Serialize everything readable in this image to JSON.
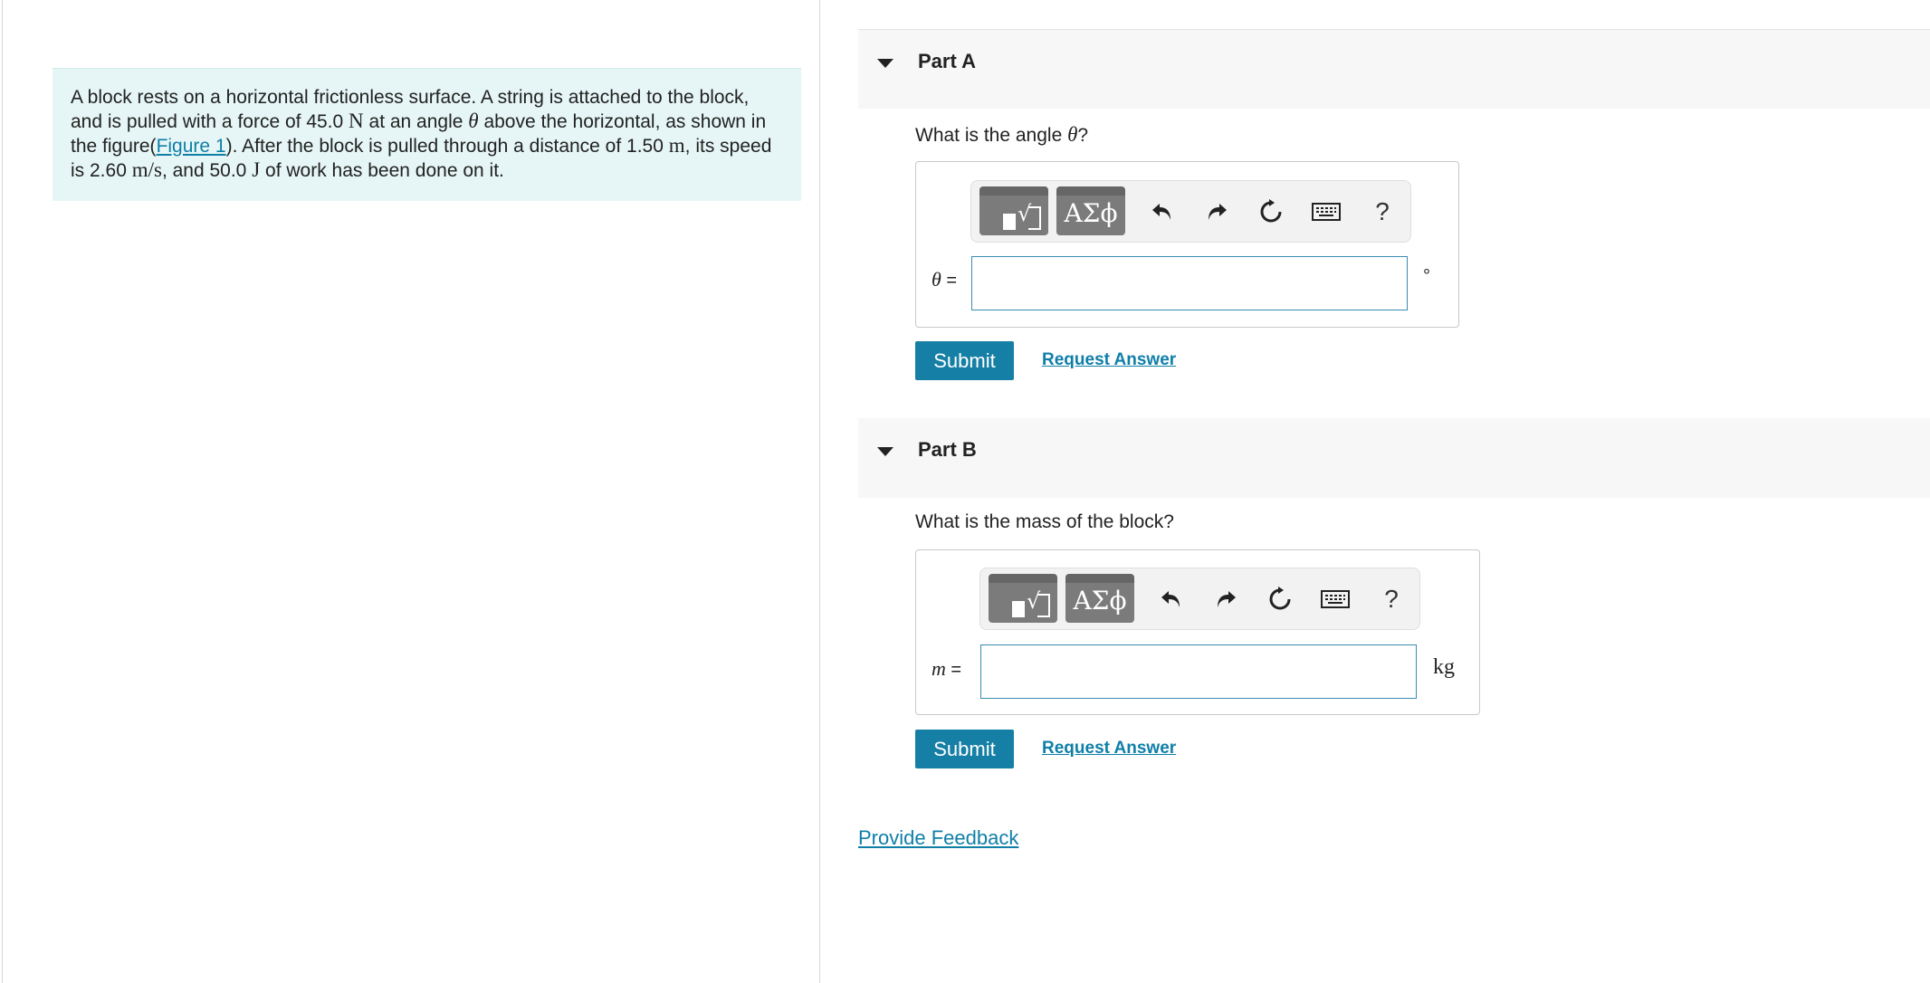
{
  "problem": {
    "text_1": "A block rests on a horizontal frictionless surface. A string is attached to the block, and is pulled with a force of 45.0",
    "unit_N": "N",
    "text_2": "at an angle",
    "theta": "θ",
    "text_3": "above the horizontal, as shown in the figure(",
    "figure_link": "Figure 1",
    "text_4": "). After the block is pulled through a distance of 1.50",
    "unit_m": "m",
    "text_5": ", its speed is 2.60",
    "unit_ms": "m/s",
    "text_6": ", and 50.0",
    "unit_J": "J",
    "text_7": "of work has been done on it."
  },
  "parts": {
    "a": {
      "title": "Part A",
      "question_prefix": "What is the angle",
      "question_var": "θ",
      "question_suffix": "?",
      "var": "θ",
      "equals": "=",
      "unit": "°",
      "input_value": "",
      "greek_label": "ΑΣϕ",
      "help": "?",
      "submit": "Submit",
      "request_answer": "Request Answer"
    },
    "b": {
      "title": "Part B",
      "question": "What is the mass of the block?",
      "var": "m",
      "equals": "=",
      "unit": "kg",
      "input_value": "",
      "greek_label": "ΑΣϕ",
      "help": "?",
      "submit": "Submit",
      "request_answer": "Request Answer"
    }
  },
  "footer": {
    "feedback": "Provide Feedback"
  },
  "colors": {
    "accent": "#167fa5",
    "link": "#0f7fa8",
    "problem_bg": "#e6f6f6",
    "header_bg": "#f7f7f7"
  },
  "icons": [
    "caret-down-icon",
    "templates-icon",
    "undo-icon",
    "redo-icon",
    "reset-icon",
    "keyboard-icon",
    "help-icon"
  ]
}
